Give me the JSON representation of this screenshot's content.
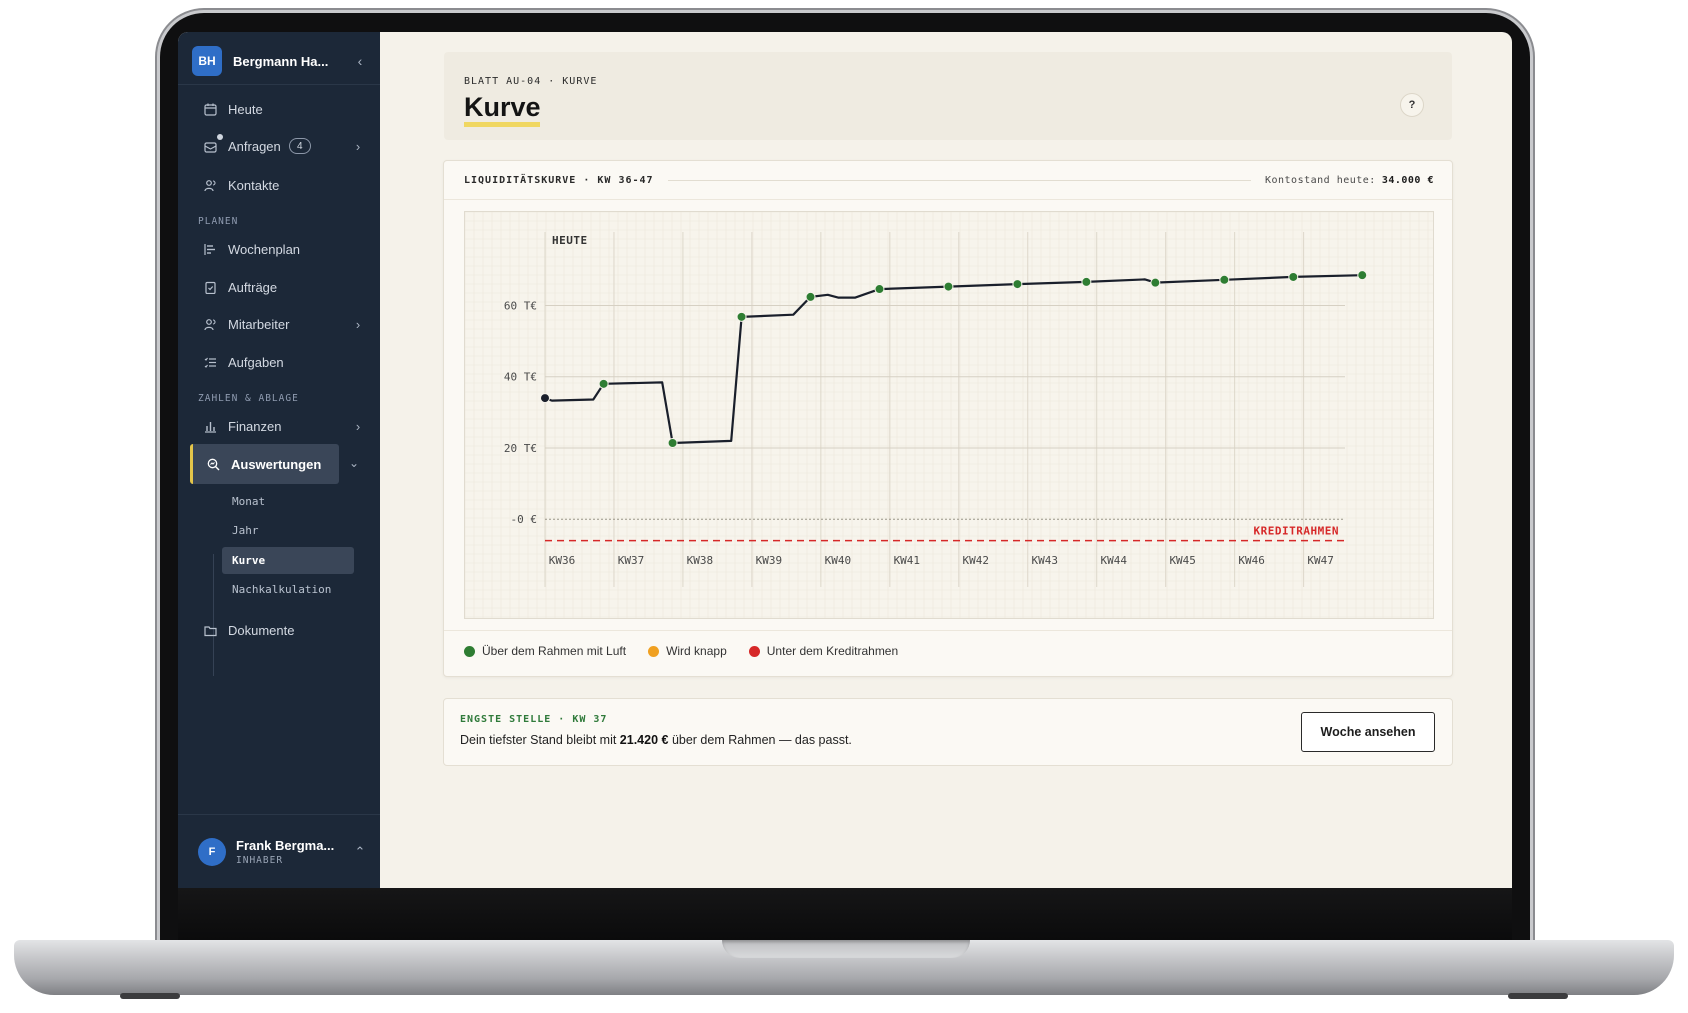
{
  "sidebar": {
    "brand_initials": "BH",
    "brand_name": "Bergmann Ha...",
    "nav_top": [
      {
        "label": "Heute",
        "icon": "calendar-icon"
      },
      {
        "label": "Anfragen",
        "icon": "inbox-icon",
        "badge": "4"
      },
      {
        "label": "Kontakte",
        "icon": "users-icon"
      }
    ],
    "section_planen": "PLANEN",
    "nav_planen": [
      {
        "label": "Wochenplan",
        "icon": "gantt-icon"
      },
      {
        "label": "Aufträge",
        "icon": "clipboard-icon"
      },
      {
        "label": "Mitarbeiter",
        "icon": "team-icon"
      },
      {
        "label": "Aufgaben",
        "icon": "checklist-icon"
      }
    ],
    "section_zahlen": "ZAHLEN & ABLAGE",
    "nav_zahlen": [
      {
        "label": "Finanzen",
        "icon": "bar-chart-icon"
      },
      {
        "label": "Auswertungen",
        "icon": "analytics-search-icon"
      }
    ],
    "subnav": [
      "Monat",
      "Jahr",
      "Kurve",
      "Nachkalkulation"
    ],
    "nav_dokumente": {
      "label": "Dokumente",
      "icon": "folder-icon"
    },
    "user": {
      "initial": "F",
      "name": "Frank Bergma...",
      "role": "INHABER"
    }
  },
  "header": {
    "crumb": "BLATT AU-04 · KURVE",
    "title": "Kurve",
    "help": "?"
  },
  "chart_card": {
    "title": "LIQUIDITÄTSKURVE · KW 36-47",
    "balance_label": "Kontostand heute:",
    "balance_value": "34.000 €",
    "legend": [
      {
        "label": "Über dem Rahmen mit Luft",
        "color": "#2e7d32"
      },
      {
        "label": "Wird knapp",
        "color": "#f0a020"
      },
      {
        "label": "Unter dem Kreditrahmen",
        "color": "#d62828"
      }
    ]
  },
  "chart_data": {
    "type": "line",
    "today_label": "HEUTE",
    "credit_label": "KREDITRAHMEN",
    "credit_line": -6000,
    "y_ticks": [
      {
        "value": 0,
        "label": "-0 €"
      },
      {
        "value": 20000,
        "label": "20 T€"
      },
      {
        "value": 40000,
        "label": "40 T€"
      },
      {
        "value": 60000,
        "label": "60 T€"
      }
    ],
    "ylim": [
      -12000,
      75000
    ],
    "x_ticks": [
      "KW36",
      "KW37",
      "KW38",
      "KW39",
      "KW40",
      "KW41",
      "KW42",
      "KW43",
      "KW44",
      "KW45",
      "KW46",
      "KW47"
    ],
    "xlim": [
      36,
      47.6
    ],
    "line": [
      [
        36,
        34000
      ],
      [
        36.1,
        33300
      ],
      [
        36.7,
        33600
      ],
      [
        36.85,
        38000
      ],
      [
        37.7,
        38400
      ],
      [
        37.85,
        21400
      ],
      [
        38.7,
        22000
      ],
      [
        38.85,
        56800
      ],
      [
        39.6,
        57400
      ],
      [
        39.85,
        62400
      ],
      [
        40.1,
        63000
      ],
      [
        40.25,
        62200
      ],
      [
        40.5,
        62200
      ],
      [
        40.85,
        64600
      ],
      [
        41.85,
        65300
      ],
      [
        42.85,
        66000
      ],
      [
        43.85,
        66600
      ],
      [
        44.7,
        67300
      ],
      [
        44.85,
        66400
      ],
      [
        45.85,
        67200
      ],
      [
        46.85,
        68000
      ],
      [
        47.85,
        68500
      ]
    ],
    "markers": [
      [
        36,
        34000,
        "today"
      ],
      [
        36.85,
        38000,
        "ok"
      ],
      [
        37.85,
        21400,
        "ok"
      ],
      [
        38.85,
        56800,
        "ok"
      ],
      [
        39.85,
        62400,
        "ok"
      ],
      [
        40.85,
        64600,
        "ok"
      ],
      [
        41.85,
        65300,
        "ok"
      ],
      [
        42.85,
        66000,
        "ok"
      ],
      [
        43.85,
        66600,
        "ok"
      ],
      [
        44.85,
        66400,
        "ok"
      ],
      [
        45.85,
        67200,
        "ok"
      ],
      [
        46.85,
        68000,
        "ok"
      ],
      [
        47.85,
        68500,
        "ok"
      ]
    ],
    "colors": {
      "line": "#1a1f2b",
      "ok": "#2e7d32",
      "today": "#1a1f2b",
      "credit": "#d62828"
    }
  },
  "insight": {
    "kicker": "ENGSTE STELLE · KW 37",
    "text_before": "Dein tiefster Stand bleibt mit ",
    "amount": "21.420 €",
    "text_after": " über dem Rahmen — das passt.",
    "button": "Woche ansehen"
  }
}
